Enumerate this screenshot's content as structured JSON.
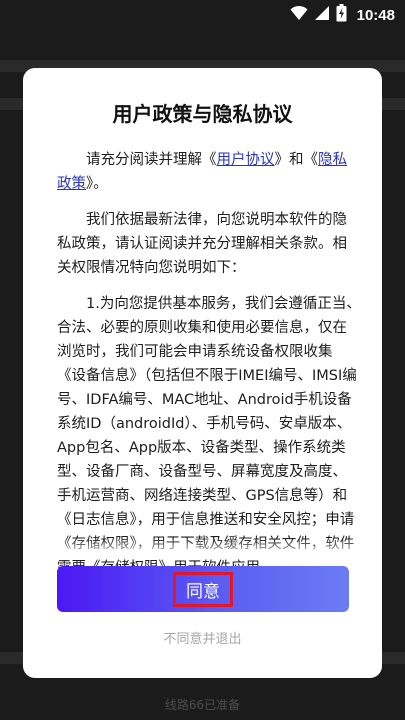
{
  "status_bar": {
    "time": "10:48",
    "icons": [
      "wifi-icon",
      "cellular-icon",
      "battery-icon"
    ]
  },
  "background": {
    "bottom_text": "线路66已准备"
  },
  "dialog": {
    "title": "用户政策与隐私协议",
    "intro": {
      "prefix": "请充分阅读并理解《",
      "user_agreement_link": "用户协议",
      "middle": "》和《",
      "privacy_link": "隐私政策",
      "suffix": "》。"
    },
    "paragraph_2": "我们依据最新法律，向您说明本软件的隐私政策，请认证阅读并充分理解相关条款。相关权限情况特向您说明如下：",
    "paragraph_3": "1.为向您提供基本服务，我们会遵循正当、合法、必要的原则收集和使用必要信息，仅在浏览时，我们可能会申请系统设备权限收集《设备信息》（包括但不限于IMEI编号、IMSI编号、IDFA编号、MAC地址、Android手机设备系统ID（androidId）、手机号码、安卓版本、App包名、App版本、设备类型、操作系统类型、设备厂商、设备型号、屏幕宽度及高度、手机运营商、网络连接类型、GPS信息等）和《日志信息》，用于信息推送和安全风控；申请《存储权限》，用于下载及缓存相关文件，软件需要《存储权限》用于软件应用",
    "agree_button": "同意",
    "decline_link": "不同意并退出"
  },
  "colors": {
    "button_gradient_start": "#4b18f5",
    "button_gradient_end": "#6a7cf3",
    "link": "#2a36b8",
    "highlight_box": "#e0182b"
  }
}
